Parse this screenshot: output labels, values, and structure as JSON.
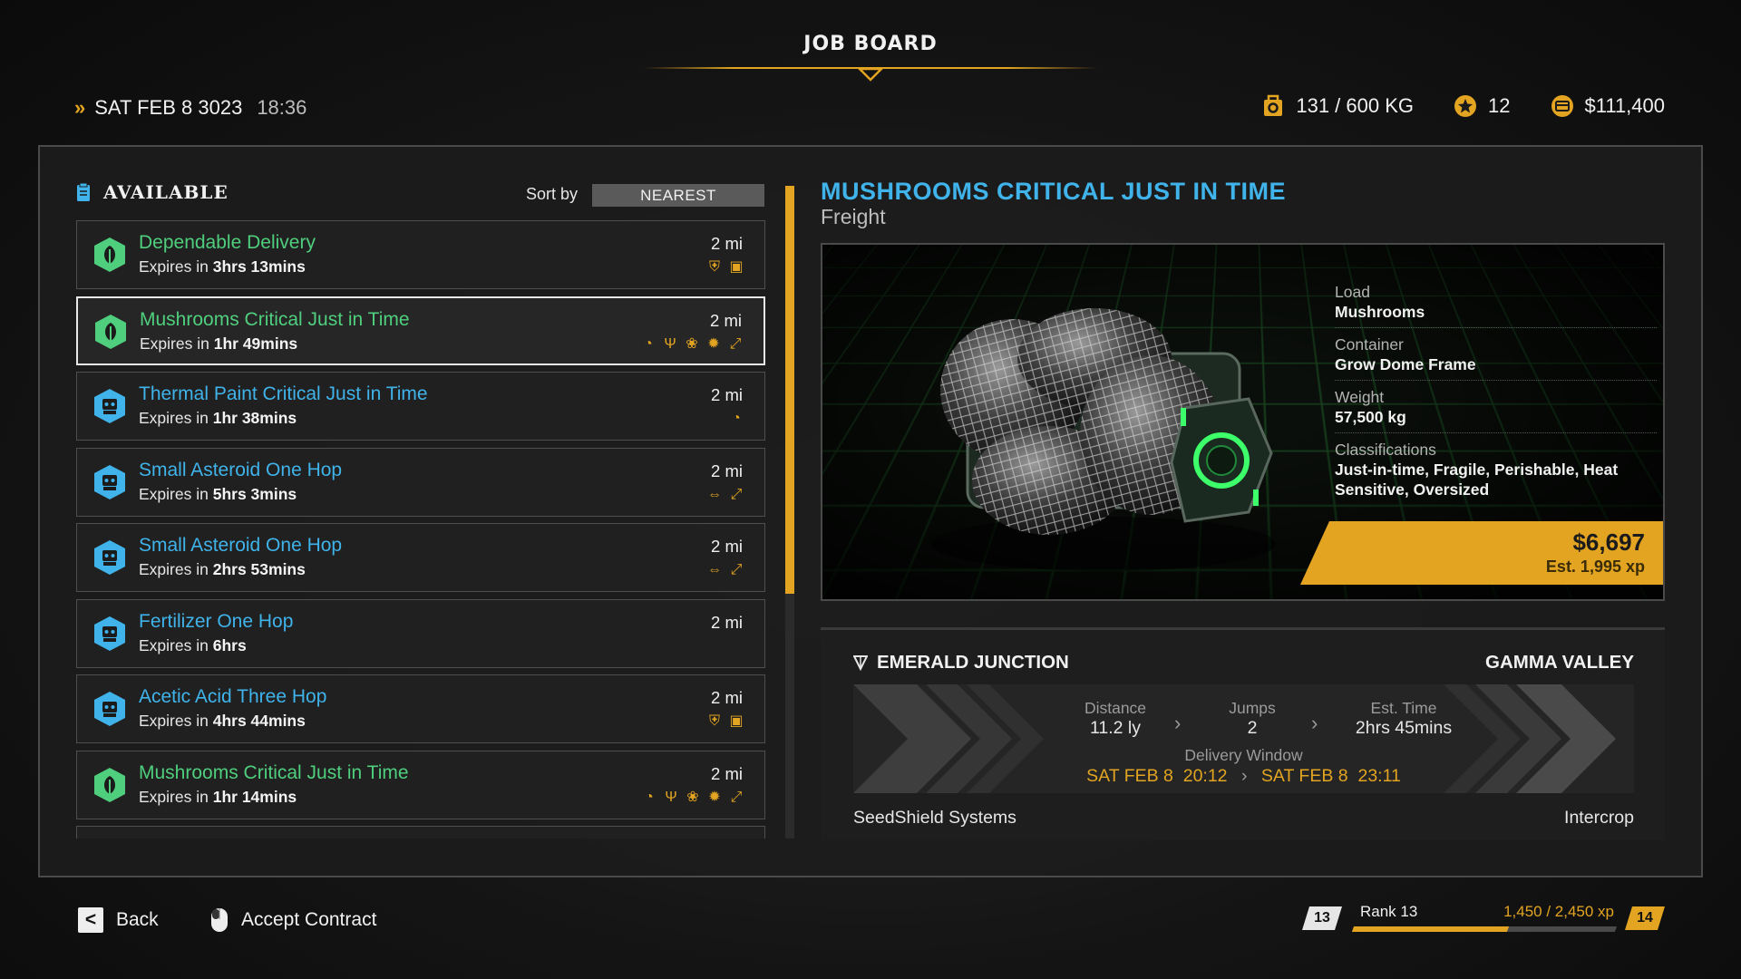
{
  "header": {
    "title": "JOB BOARD",
    "date": "SAT FEB 8 3023",
    "time": "18:36",
    "cargo": "131 / 600 KG",
    "stars": "12",
    "credits": "$111,400"
  },
  "list": {
    "heading": "AVAILABLE",
    "sort_label": "Sort by",
    "sort_value": "NEAREST",
    "expires_prefix": "Expires in",
    "jobs": [
      {
        "name": "Dependable Delivery",
        "expires": "3hrs 13mins",
        "distance": "2 mi",
        "type": "green",
        "selected": false,
        "icons": [
          "shield-icon",
          "box-icon"
        ]
      },
      {
        "name": "Mushrooms Critical Just in Time",
        "expires": "1hr 49mins",
        "distance": "2 mi",
        "type": "green",
        "selected": true,
        "icons": [
          "clock-icon",
          "fragile-icon",
          "perishable-icon",
          "heat-icon",
          "oversized-icon"
        ]
      },
      {
        "name": "Thermal Paint Critical Just in Time",
        "expires": "1hr 38mins",
        "distance": "2 mi",
        "type": "blue",
        "selected": false,
        "icons": [
          "clock-icon"
        ]
      },
      {
        "name": "Small Asteroid One Hop",
        "expires": "5hrs 3mins",
        "distance": "2 mi",
        "type": "blue",
        "selected": false,
        "icons": [
          "heavy-icon",
          "oversized-icon"
        ]
      },
      {
        "name": "Small Asteroid One Hop",
        "expires": "2hrs 53mins",
        "distance": "2 mi",
        "type": "blue",
        "selected": false,
        "icons": [
          "heavy-icon",
          "oversized-icon"
        ]
      },
      {
        "name": "Fertilizer One Hop",
        "expires": "6hrs",
        "distance": "2 mi",
        "type": "blue",
        "selected": false,
        "icons": []
      },
      {
        "name": "Acetic Acid Three Hop",
        "expires": "4hrs 44mins",
        "distance": "2 mi",
        "type": "blue",
        "selected": false,
        "icons": [
          "shield-icon",
          "box-icon"
        ]
      },
      {
        "name": "Mushrooms Critical Just in Time",
        "expires": "1hr 14mins",
        "distance": "2 mi",
        "type": "green",
        "selected": false,
        "icons": [
          "clock-icon",
          "fragile-icon",
          "perishable-icon",
          "heat-icon",
          "oversized-icon"
        ]
      }
    ]
  },
  "detail": {
    "title": "MUSHROOMS CRITICAL JUST IN TIME",
    "subtitle": "Freight",
    "specs": [
      {
        "label": "Load",
        "value": "Mushrooms"
      },
      {
        "label": "Container",
        "value": "Grow Dome Frame"
      },
      {
        "label": "Weight",
        "value": "57,500 kg"
      },
      {
        "label": "Classifications",
        "value": "Just-in-time, Fragile, Perishable, Heat Sensitive, Oversized"
      }
    ],
    "reward": "$6,697",
    "xp": "Est. 1,995 xp"
  },
  "route": {
    "from": "EMERALD JUNCTION",
    "to": "GAMMA VALLEY",
    "distance_label": "Distance",
    "distance": "11.2 ly",
    "jumps_label": "Jumps",
    "jumps": "2",
    "time_label": "Est. Time",
    "time": "2hrs 45mins",
    "window_label": "Delivery Window",
    "window_start_date": "SAT FEB 8",
    "window_start_time": "20:12",
    "window_end_date": "SAT FEB 8",
    "window_end_time": "23:11",
    "shipper": "SeedShield Systems",
    "receiver": "Intercrop"
  },
  "footer": {
    "back_key": "<",
    "back_label": "Back",
    "accept_label": "Accept Contract",
    "rank_current": "13",
    "rank_label": "Rank 13",
    "rank_xp": "1,450 / 2,450 xp",
    "rank_next": "14",
    "rank_progress": 0.59
  },
  "colors": {
    "accent": "#e3a521",
    "job_green": "#4fcf7d",
    "job_blue": "#3fb3ea"
  }
}
